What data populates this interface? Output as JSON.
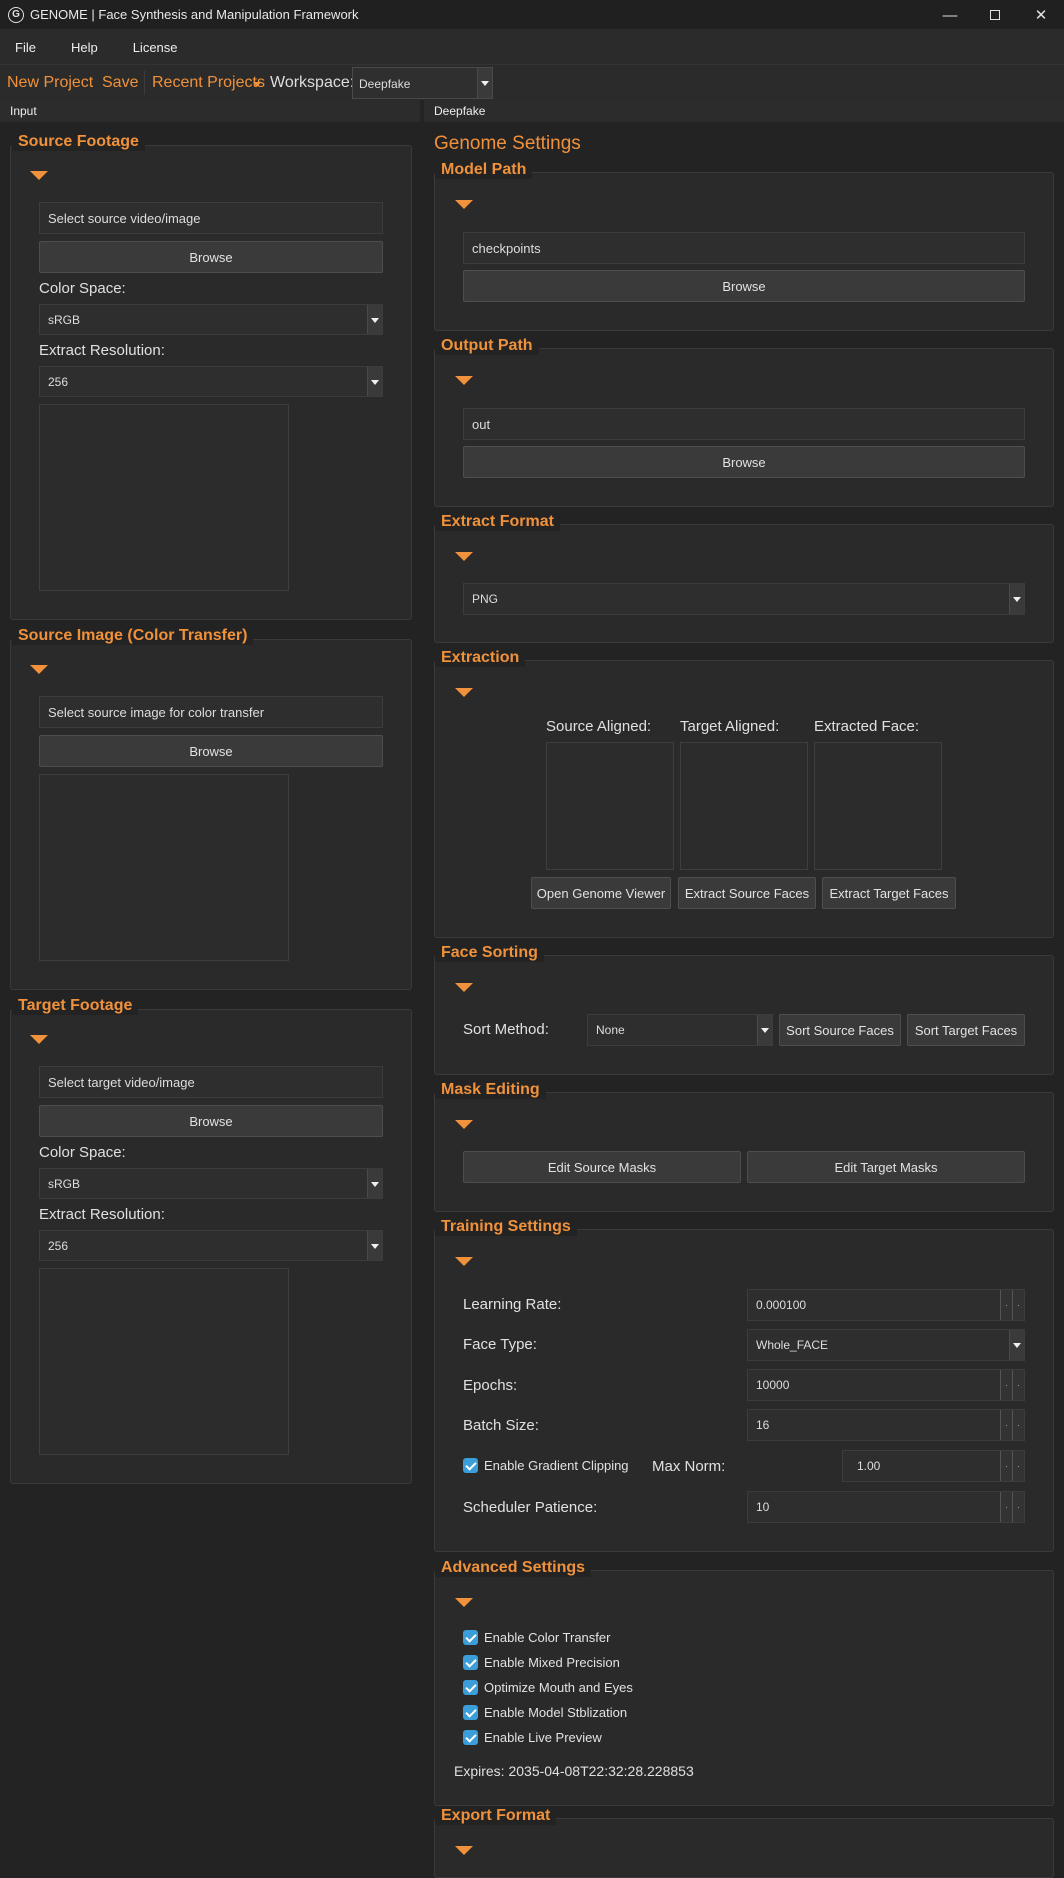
{
  "window": {
    "title": "GENOME | Face Synthesis and Manipulation Framework",
    "logo": "G"
  },
  "menu": [
    "File",
    "Help",
    "License"
  ],
  "toolbar": {
    "new_project": "New Project",
    "save": "Save",
    "recent": "Recent Projects",
    "workspace_label": "Workspace:",
    "workspace_value": "Deepfake"
  },
  "tabs": {
    "left": "Input",
    "right": "Deepfake"
  },
  "source_footage": {
    "title": "Source Footage",
    "path_placeholder": "Select source video/image",
    "browse": "Browse",
    "color_space_label": "Color Space:",
    "color_space": "sRGB",
    "resolution_label": "Extract Resolution:",
    "resolution": "256"
  },
  "source_image": {
    "title": "Source Image (Color Transfer)",
    "path_placeholder": "Select source image for color transfer",
    "browse": "Browse"
  },
  "target_footage": {
    "title": "Target Footage",
    "path_placeholder": "Select target video/image",
    "browse": "Browse",
    "color_space_label": "Color Space:",
    "color_space": "sRGB",
    "resolution_label": "Extract Resolution:",
    "resolution": "256"
  },
  "genome_settings": {
    "heading": "Genome Settings"
  },
  "model_path": {
    "title": "Model Path",
    "value": "checkpoints",
    "browse": "Browse"
  },
  "output_path": {
    "title": "Output Path",
    "value": "out",
    "browse": "Browse"
  },
  "extract_format": {
    "title": "Extract Format",
    "value": "PNG"
  },
  "extraction": {
    "title": "Extraction",
    "source_label": "Source Aligned:",
    "target_label": "Target Aligned:",
    "face_label": "Extracted Face:",
    "open_viewer": "Open Genome Viewer",
    "extract_source": "Extract Source Faces",
    "extract_target": "Extract Target Faces"
  },
  "face_sorting": {
    "title": "Face Sorting",
    "sort_label": "Sort Method:",
    "sort_value": "None",
    "sort_source": "Sort Source Faces",
    "sort_target": "Sort Target Faces"
  },
  "mask_editing": {
    "title": "Mask Editing",
    "edit_source": "Edit Source Masks",
    "edit_target": "Edit Target Masks"
  },
  "training": {
    "title": "Training Settings",
    "lr_label": "Learning Rate:",
    "lr": "0.000100",
    "face_type_label": "Face Type:",
    "face_type": "Whole_FACE",
    "epochs_label": "Epochs:",
    "epochs": "10000",
    "batch_label": "Batch Size:",
    "batch": "16",
    "grad_clip_label": "Enable Gradient Clipping",
    "grad_clip_checked": true,
    "max_norm_label": "Max Norm:",
    "max_norm": "1.00",
    "patience_label": "Scheduler Patience:",
    "patience": "10"
  },
  "advanced": {
    "title": "Advanced Settings",
    "options": [
      {
        "label": "Enable Color Transfer",
        "checked": true
      },
      {
        "label": "Enable Mixed Precision",
        "checked": true
      },
      {
        "label": "Optimize Mouth and Eyes",
        "checked": true
      },
      {
        "label": "Enable Model Stblization",
        "checked": true
      },
      {
        "label": "Enable Live Preview",
        "checked": true
      }
    ],
    "expires": "Expires: 2035-04-08T22:32:28.228853"
  },
  "export_format": {
    "title": "Export Format"
  },
  "colors": {
    "accent": "#f0913b",
    "check": "#3b9ed8",
    "bg": "#232323"
  }
}
